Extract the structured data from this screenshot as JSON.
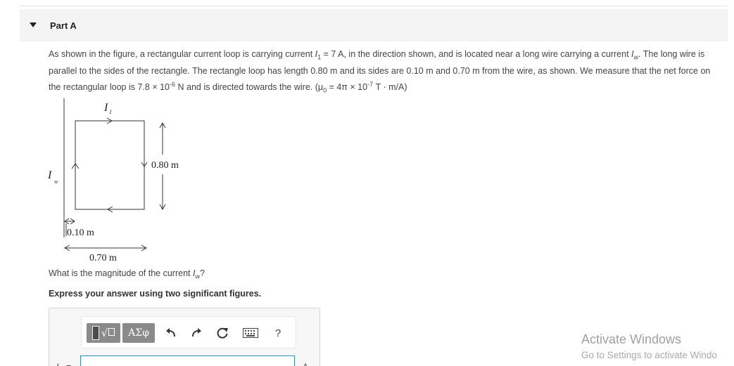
{
  "part": {
    "title": "Part A"
  },
  "problem": {
    "p1": "As shown in the figure, a rectangular current loop is carrying current ",
    "I1_symbol": "I",
    "I1_sub": "1",
    "p2": " = 7 A, in the direction shown, and is located near a long wire carrying a current ",
    "Iw_symbol": "I",
    "Iw_sub": "w",
    "p3": ". The long wire is parallel to the sides of the rectangle. The rectangle loop has length 0.80 m and its sides are 0.10 m and 0.70 m from the wire, as shown. We measure that the net force on the rectangular loop is 7.8 × 10",
    "force_exp": "-6",
    "p4": " N and is directed towards the wire. (μ",
    "mu_sub": "0",
    "p5": " = 4π × 10",
    "mu_exp": "-7",
    "p6": " T · m/A)"
  },
  "figure": {
    "label_I1": "I",
    "label_I1_sub": "1",
    "label_Iw": "I",
    "label_Iw_sub": "w",
    "length_label": "0.80 m",
    "near_distance_label": "0.10 m",
    "far_distance_label": "0.70 m"
  },
  "question": {
    "text": "What is the magnitude of the current ",
    "symbol": "I",
    "sub": "w",
    "end": "?"
  },
  "instruction": "Express your answer using two significant figures.",
  "answer": {
    "label": "I",
    "label_sub": "w",
    "label_eq": "=",
    "value": "",
    "units": "A"
  },
  "toolbar": {
    "templates_icon": "templates-sqrt-icon",
    "greek_label": "ΑΣφ",
    "undo_icon": "undo-icon",
    "redo_icon": "redo-icon",
    "reset_icon": "reset-icon",
    "keyboard_icon": "keyboard-icon",
    "help_label": "?"
  },
  "watermark": {
    "title": "Activate Windows",
    "subtitle": "Go to Settings to activate Windo"
  }
}
